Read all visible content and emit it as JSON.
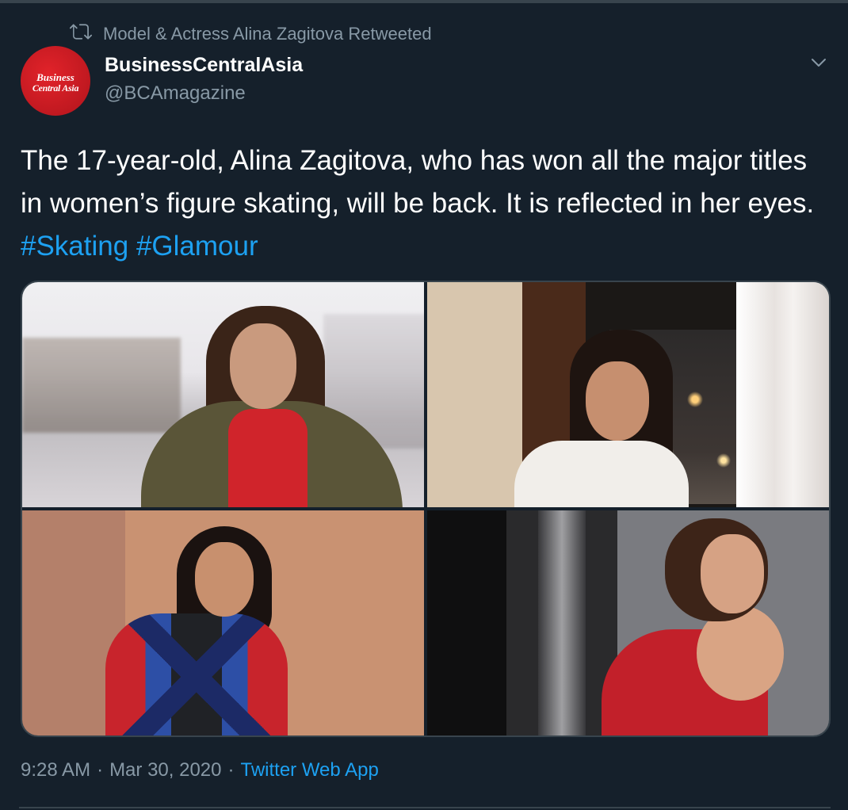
{
  "retweet": {
    "text": "Model & Actress Alina Zagitova Retweeted",
    "icon": "retweet-icon"
  },
  "author": {
    "name": "BusinessCentralAsia",
    "handle": "@BCAmagazine",
    "avatar_text_1": "Business",
    "avatar_text_2": "Central Asia",
    "avatar_color": "#c8161e"
  },
  "tweet": {
    "text": "The 17-year-old, Alina Zagitova, who has won all the major titles in women’s figure skating, will be back. It is reflected in her eyes.",
    "hashtags": [
      "#Skating",
      "#Glamour"
    ]
  },
  "media": {
    "count": 4
  },
  "meta": {
    "time": "9:28 AM",
    "separator": "·",
    "date": "Mar 30, 2020",
    "app": "Twitter Web App"
  },
  "colors": {
    "background": "#15202b",
    "accent": "#1da1f2",
    "secondary_text": "#8899a6",
    "border": "#38444d"
  }
}
